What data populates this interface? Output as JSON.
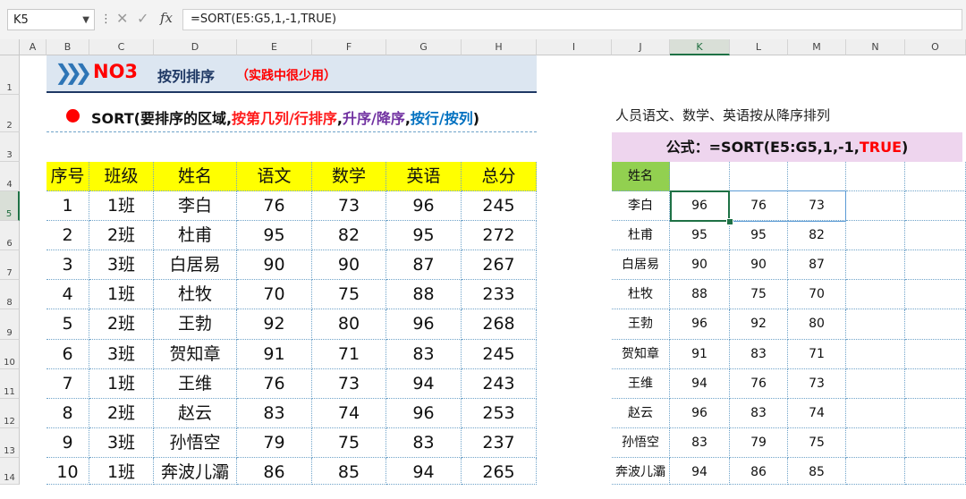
{
  "formula_bar": {
    "name_box": "K5",
    "formula": "=SORT(E5:G5,1,-1,TRUE)"
  },
  "columns": [
    "A",
    "B",
    "C",
    "D",
    "E",
    "F",
    "G",
    "H",
    "I",
    "J",
    "K",
    "L",
    "M",
    "N",
    "O"
  ],
  "rows": [
    "1",
    "2",
    "3",
    "4",
    "5",
    "6",
    "7",
    "8",
    "9",
    "10",
    "11",
    "12",
    "13",
    "14"
  ],
  "banner": {
    "title_no": "NO3",
    "title": "按列排序",
    "subtitle": "（实践中很少用）"
  },
  "syntax": {
    "p1": "SORT(要排序的区域,",
    "p2": "按第几列/行排序",
    "p3": ",",
    "p4": "升序/降序",
    "p5": ",",
    "p6": "按行/按列",
    "p7": ")"
  },
  "left_table": {
    "headers": [
      "序号",
      "班级",
      "姓名",
      "语文",
      "数学",
      "英语",
      "总分"
    ],
    "rows": [
      [
        "1",
        "1班",
        "李白",
        "76",
        "73",
        "96",
        "245"
      ],
      [
        "2",
        "2班",
        "杜甫",
        "95",
        "82",
        "95",
        "272"
      ],
      [
        "3",
        "3班",
        "白居易",
        "90",
        "90",
        "87",
        "267"
      ],
      [
        "4",
        "1班",
        "杜牧",
        "70",
        "75",
        "88",
        "233"
      ],
      [
        "5",
        "2班",
        "王勃",
        "92",
        "80",
        "96",
        "268"
      ],
      [
        "6",
        "3班",
        "贺知章",
        "91",
        "71",
        "83",
        "245"
      ],
      [
        "7",
        "1班",
        "王维",
        "76",
        "73",
        "94",
        "243"
      ],
      [
        "8",
        "2班",
        "赵云",
        "83",
        "74",
        "96",
        "253"
      ],
      [
        "9",
        "3班",
        "孙悟空",
        "79",
        "75",
        "83",
        "237"
      ],
      [
        "10",
        "1班",
        "奔波儿灞",
        "86",
        "85",
        "94",
        "265"
      ]
    ]
  },
  "right_panel": {
    "description": "人员语文、数学、英语按从降序排列",
    "formula_label": "公式：=SORT(E5:G5,1,-1,",
    "formula_true": "TRUE",
    "formula_end": ")",
    "header": "姓名",
    "rows": [
      [
        "李白",
        "96",
        "76",
        "73"
      ],
      [
        "杜甫",
        "95",
        "95",
        "82"
      ],
      [
        "白居易",
        "90",
        "90",
        "87"
      ],
      [
        "杜牧",
        "88",
        "75",
        "70"
      ],
      [
        "王勃",
        "96",
        "92",
        "80"
      ],
      [
        "贺知章",
        "91",
        "83",
        "71"
      ],
      [
        "王维",
        "94",
        "76",
        "73"
      ],
      [
        "赵云",
        "96",
        "83",
        "74"
      ],
      [
        "孙悟空",
        "83",
        "79",
        "75"
      ],
      [
        "奔波儿灞",
        "94",
        "86",
        "85"
      ]
    ]
  }
}
